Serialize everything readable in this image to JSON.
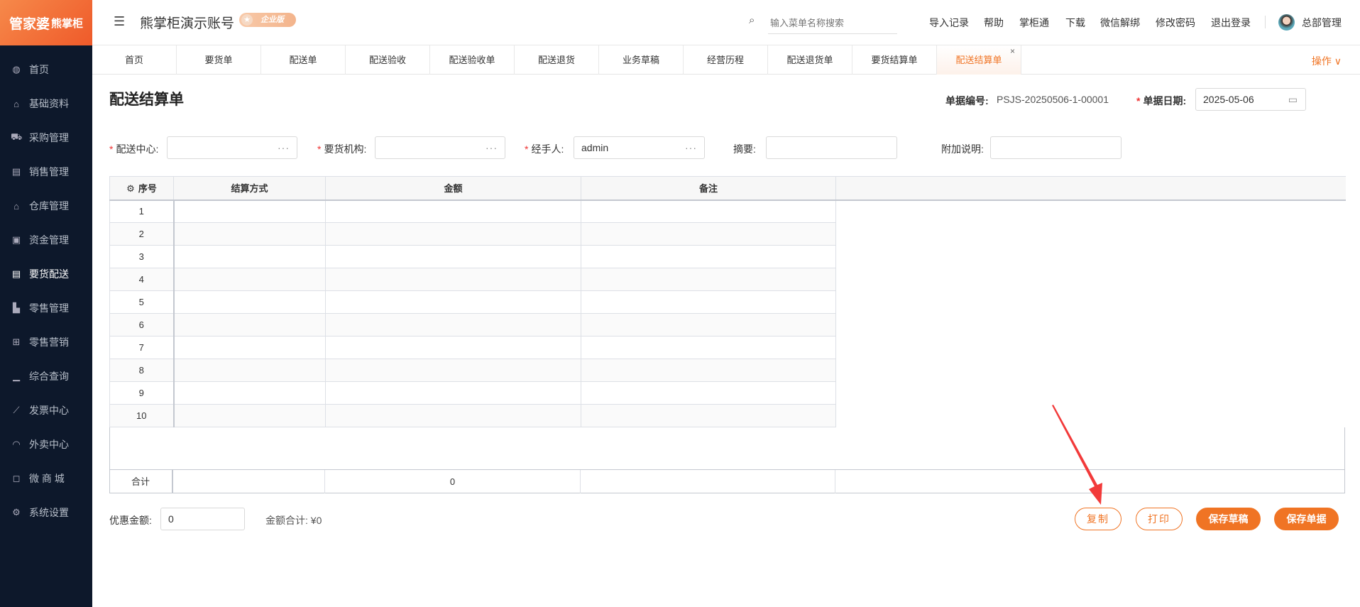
{
  "brand": {
    "logo": "管家婆",
    "logo_sub": "熊掌柜"
  },
  "sidebar": {
    "items": [
      {
        "label": "首页",
        "icon": "globe-icon"
      },
      {
        "label": "基础资料",
        "icon": "home-icon"
      },
      {
        "label": "采购管理",
        "icon": "cart-icon"
      },
      {
        "label": "销售管理",
        "icon": "calendar-icon"
      },
      {
        "label": "仓库管理",
        "icon": "bank-icon"
      },
      {
        "label": "资金管理",
        "icon": "wallet-icon"
      },
      {
        "label": "要货配送",
        "icon": "list-icon",
        "active": true
      },
      {
        "label": "零售管理",
        "icon": "area-chart-icon"
      },
      {
        "label": "零售营销",
        "icon": "gift-icon"
      },
      {
        "label": "综合查询",
        "icon": "bar-chart-icon"
      },
      {
        "label": "发票中心",
        "icon": "line-chart-icon"
      },
      {
        "label": "外卖中心",
        "icon": "alarm-icon"
      },
      {
        "label": "微 商 城",
        "icon": "bag-icon"
      },
      {
        "label": "系统设置",
        "icon": "gear-icon"
      }
    ]
  },
  "header": {
    "account": "熊掌柜演示账号",
    "edition": "企业版",
    "search_placeholder": "输入菜单名称搜索",
    "links": [
      "导入记录",
      "帮助",
      "掌柜通",
      "下载",
      "微信解绑",
      "修改密码",
      "退出登录"
    ],
    "user": "总部管理"
  },
  "tabs": {
    "items": [
      "首页",
      "要货单",
      "配送单",
      "配送验收",
      "配送验收单",
      "配送退货",
      "业务草稿",
      "经营历程",
      "配送退货单",
      "要货结算单",
      "配送结算单"
    ],
    "active": "配送结算单",
    "operate": "操作 ∨"
  },
  "form": {
    "title": "配送结算单",
    "doc_no_label": "单据编号:",
    "doc_no": "PSJS-20250506-1-00001",
    "date_label": "单据日期:",
    "date": "2025-05-06",
    "center_label": "配送中心:",
    "center": "",
    "org_label": "要货机构:",
    "org": "",
    "handler_label": "经手人:",
    "handler": "admin",
    "summary_label": "摘要:",
    "summary": "",
    "note_label": "附加说明:",
    "note": "",
    "ellipsis": "···",
    "required": "*"
  },
  "table": {
    "headers": [
      "序号",
      "结算方式",
      "金额",
      "备注"
    ],
    "rows": [
      "1",
      "2",
      "3",
      "4",
      "5",
      "6",
      "7",
      "8",
      "9",
      "10"
    ],
    "total_label": "合计",
    "total_amount": "0"
  },
  "footer": {
    "discount_label": "优惠金额:",
    "discount": "0",
    "sum_label": "金额合计:",
    "sum": "¥0",
    "buttons": {
      "copy": "复制",
      "print": "打印",
      "save_draft": "保存草稿",
      "save": "保存单据"
    }
  },
  "colors": {
    "accent": "#f07424",
    "sidebar": "#0d182b",
    "annotation_arrow": "#f23a3a"
  }
}
